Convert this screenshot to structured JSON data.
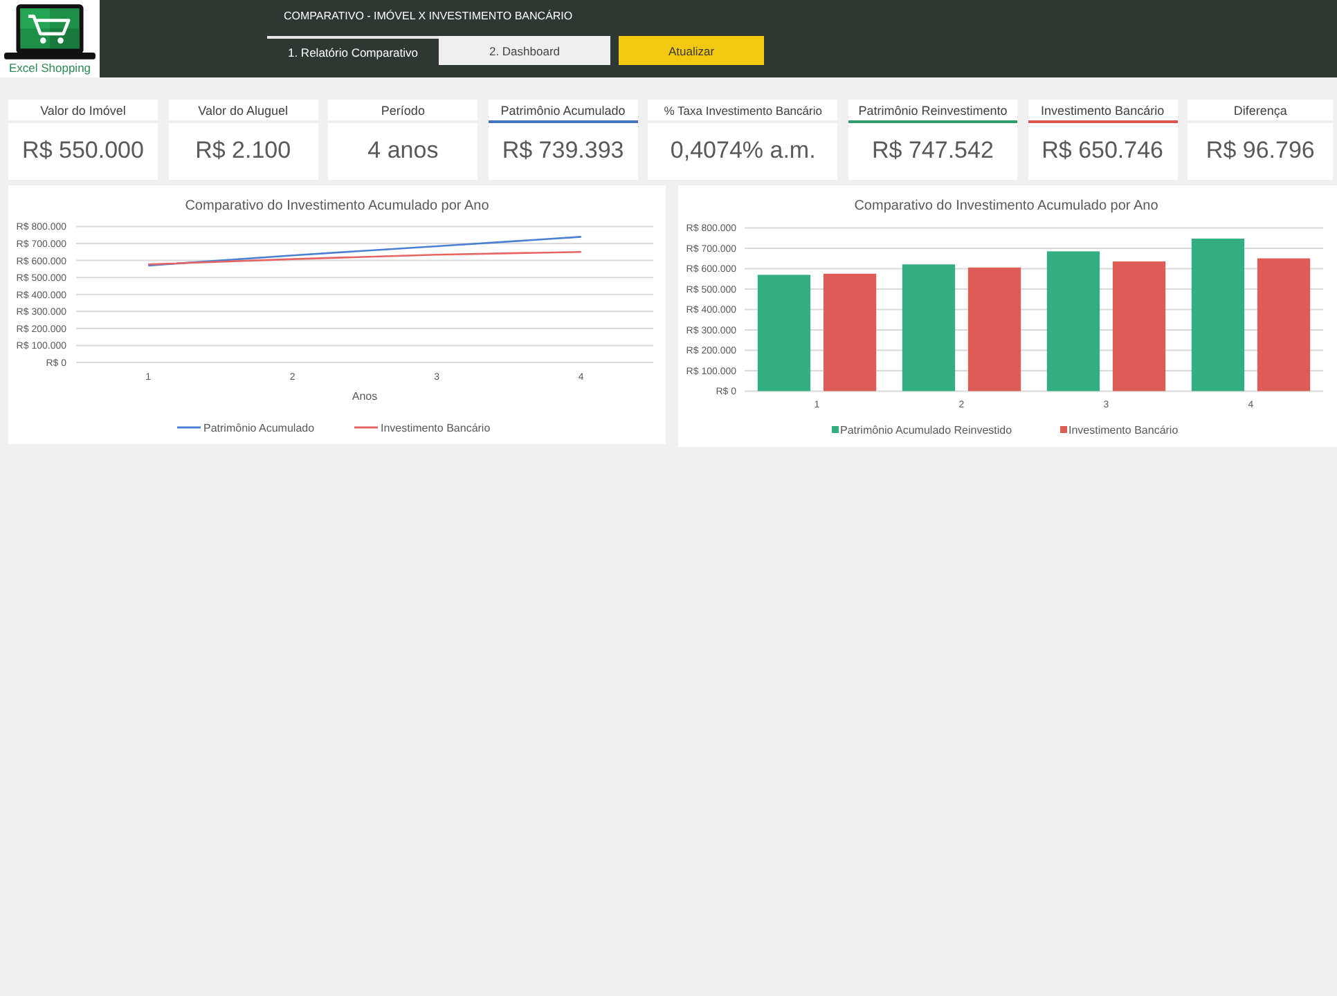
{
  "logo": {
    "text": "Excel Shopping"
  },
  "header": {
    "title": "COMPARATIVO - IMÓVEL X INVESTIMENTO BANCÁRIO",
    "tabs": [
      {
        "label": "1. Relatório Comparativo",
        "selected": true
      },
      {
        "label": "2. Dashboard",
        "selected": false
      }
    ],
    "button": "Atualizar"
  },
  "kpis": [
    {
      "label": "Valor do Imóvel",
      "value": "R$ 550.000"
    },
    {
      "label": "Valor do Aluguel",
      "value": "R$ 2.100"
    },
    {
      "label": "Período",
      "value": "4 anos"
    },
    {
      "label": "Patrimônio Acumulado",
      "value": "R$ 739.393",
      "color": "#4472c4"
    },
    {
      "label": "% Taxa Investimento Bancário",
      "value": "0,4074% a.m."
    },
    {
      "label": "Patrimônio Reinvestimento",
      "value": "R$ 747.542",
      "color": "#2e9e6e"
    },
    {
      "label": "Investimento Bancário",
      "value": "R$ 650.746",
      "color": "#d9534f"
    },
    {
      "label": "Diferença",
      "value": "R$ 96.796"
    }
  ],
  "line_chart": {
    "title": "Comparativo do Investimento Acumulado por Ano",
    "y_axis_labels": [
      "R$ 800.000",
      "R$ 700.000",
      "R$ 600.000",
      "R$ 500.000",
      "R$ 400.000",
      "R$ 300.000",
      "R$ 200.000",
      "R$ 100.000",
      "R$ 0"
    ],
    "x_axis_labels": [
      "1",
      "2",
      "3",
      "4"
    ],
    "x_axis_title": "Anos",
    "legend": [
      {
        "name": "Patrimônio Acumulado",
        "color": "#4a80d4"
      },
      {
        "name": "Investimento Bancário",
        "color": "#e66461"
      }
    ]
  },
  "bar_chart": {
    "title": "Comparativo do Investimento Acumulado por Ano",
    "y_axis_labels": [
      "R$ 800.000",
      "R$ 700.000",
      "R$ 600.000",
      "R$ 500.000",
      "R$ 400.000",
      "R$ 300.000",
      "R$ 200.000",
      "R$ 100.000",
      "R$ 0"
    ],
    "x_axis_labels": [
      "1",
      "2",
      "3",
      "4"
    ],
    "legend": [
      {
        "name": "Patrimônio Acumulado Reinvestido",
        "color": "#33ae80"
      },
      {
        "name": "Investimento Bancário",
        "color": "#dd5c56"
      }
    ]
  }
}
